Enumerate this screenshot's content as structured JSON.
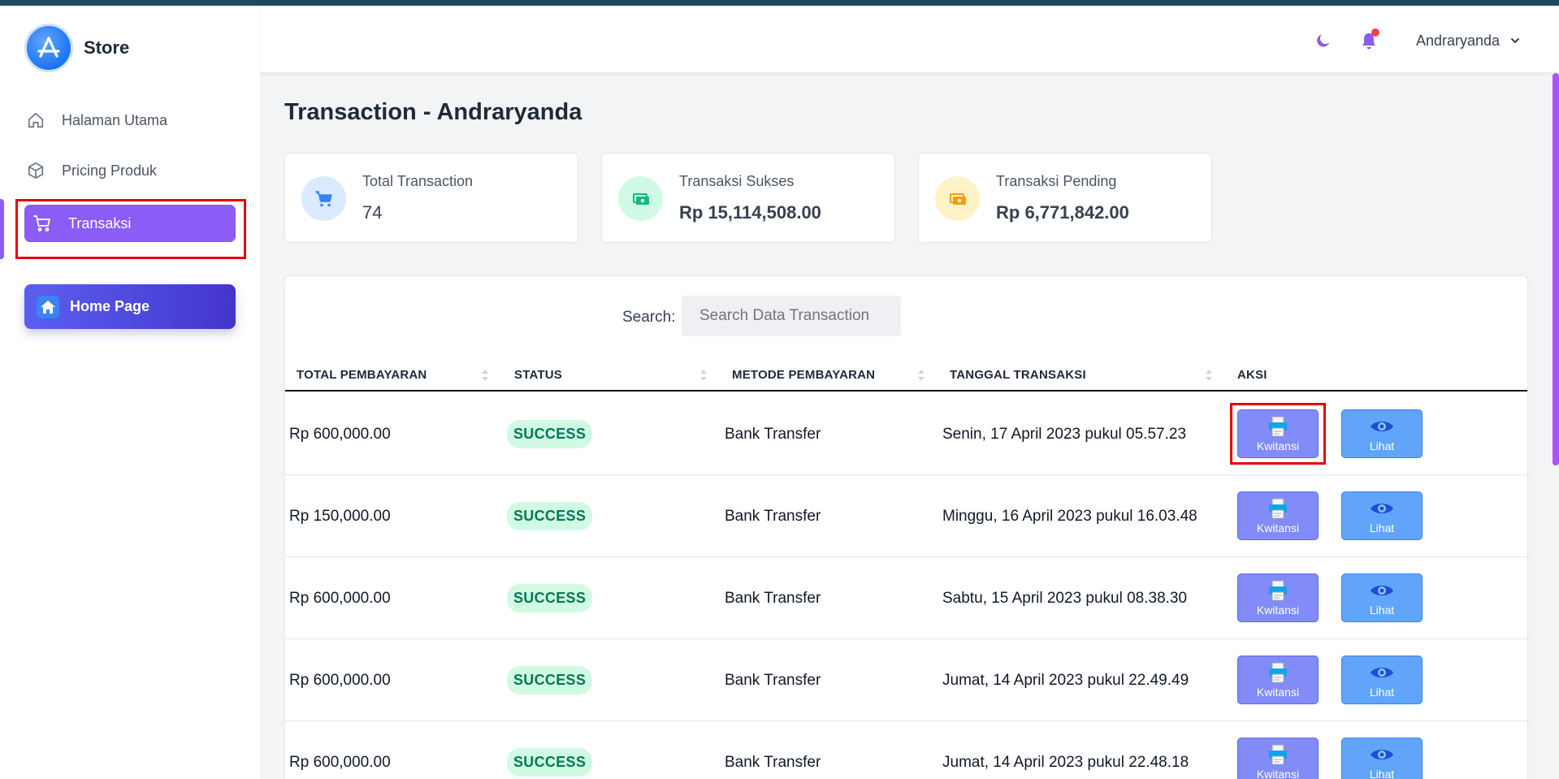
{
  "brand": {
    "name": "Store"
  },
  "sidebar": {
    "items": [
      {
        "label": "Halaman Utama",
        "icon": "home-icon"
      },
      {
        "label": "Pricing Produk",
        "icon": "box-icon"
      },
      {
        "label": "Transaksi",
        "icon": "cart-icon",
        "active": true
      }
    ],
    "home_button": {
      "label": "Home Page",
      "icon": "home-icon"
    }
  },
  "header": {
    "user_name": "Andraryanda",
    "theme_icon": "moon-icon",
    "notify_icon": "bell-icon"
  },
  "page": {
    "title": "Transaction - Andraryanda"
  },
  "cards": [
    {
      "label": "Total Transaction",
      "value": "74",
      "icon": "cart-icon",
      "color": "#3b82f6"
    },
    {
      "label": "Transaksi Sukses",
      "value": "Rp 15,114,508.00",
      "icon": "money-icon",
      "color": "#10b981"
    },
    {
      "label": "Transaksi Pending",
      "value": "Rp 6,771,842.00",
      "icon": "money-icon",
      "color": "#f59e0b"
    }
  ],
  "search": {
    "label": "Search:",
    "placeholder": "Search Data Transaction"
  },
  "table": {
    "columns": [
      "TOTAL PEMBAYARAN",
      "STATUS",
      "METODE PEMBAYARAN",
      "TANGGAL TRANSAKSI",
      "AKSI"
    ],
    "rows": [
      {
        "total": "Rp 600,000.00",
        "status": "SUCCESS",
        "method": "Bank Transfer",
        "date": "Senin, 17 April 2023 pukul 05.57.23"
      },
      {
        "total": "Rp 150,000.00",
        "status": "SUCCESS",
        "method": "Bank Transfer",
        "date": "Minggu, 16 April 2023 pukul 16.03.48"
      },
      {
        "total": "Rp 600,000.00",
        "status": "SUCCESS",
        "method": "Bank Transfer",
        "date": "Sabtu, 15 April 2023 pukul 08.38.30"
      },
      {
        "total": "Rp 600,000.00",
        "status": "SUCCESS",
        "method": "Bank Transfer",
        "date": "Jumat, 14 April 2023 pukul 22.49.49"
      },
      {
        "total": "Rp 600,000.00",
        "status": "SUCCESS",
        "method": "Bank Transfer",
        "date": "Jumat, 14 April 2023 pukul 22.48.18"
      }
    ],
    "actions": {
      "receipt_label": "Kwitansi",
      "view_label": "Lihat"
    }
  },
  "colors": {
    "accent": "#8b5cf6",
    "highlight": "#e60000",
    "success_bg": "#d1fae5",
    "success_text": "#047857"
  }
}
